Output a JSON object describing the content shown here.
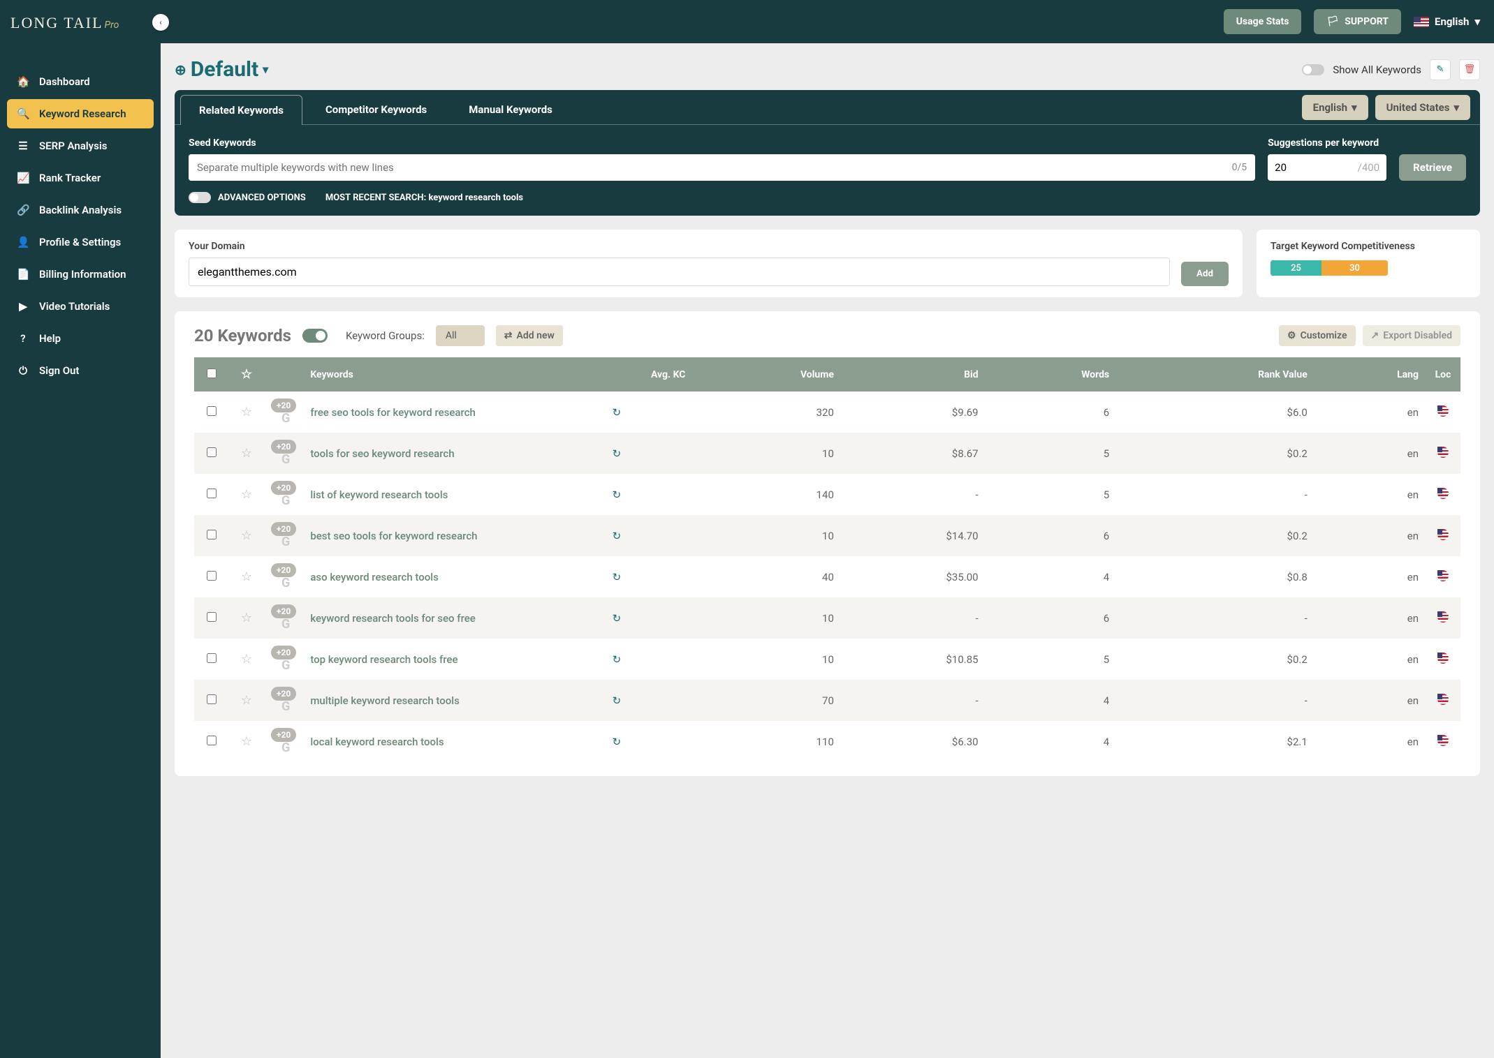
{
  "brand": {
    "name": "LONG TAIL",
    "suffix": "Pro"
  },
  "header": {
    "usage": "Usage Stats",
    "support": "SUPPORT",
    "language": "English"
  },
  "sidebar": {
    "items": [
      {
        "icon": "🏠",
        "label": "Dashboard"
      },
      {
        "icon": "🔍",
        "label": "Keyword Research"
      },
      {
        "icon": "☰",
        "label": "SERP Analysis"
      },
      {
        "icon": "📈",
        "label": "Rank Tracker"
      },
      {
        "icon": "🔗",
        "label": "Backlink Analysis"
      },
      {
        "icon": "👤",
        "label": "Profile & Settings"
      },
      {
        "icon": "📄",
        "label": "Billing Information"
      },
      {
        "icon": "▶",
        "label": "Video Tutorials"
      },
      {
        "icon": "?",
        "label": "Help"
      },
      {
        "icon": "⏻",
        "label": "Sign Out"
      }
    ]
  },
  "project": {
    "name": "Default",
    "show_all_label": "Show All Keywords"
  },
  "tabs": {
    "related": "Related Keywords",
    "competitor": "Competitor Keywords",
    "manual": "Manual Keywords",
    "lang_filter": "English",
    "country_filter": "United States"
  },
  "seed": {
    "label": "Seed Keywords",
    "placeholder": "Separate multiple keywords with new lines",
    "count": "0/5",
    "sugg_label": "Suggestions per keyword",
    "sugg_value": "20",
    "sugg_max": "/400",
    "retrieve": "Retrieve",
    "advanced": "ADVANCED OPTIONS",
    "recent_prefix": "MOST RECENT SEARCH: ",
    "recent_value": "keyword research tools"
  },
  "domain": {
    "label": "Your Domain",
    "value": "elegantthemes.com",
    "add": "Add"
  },
  "tkc": {
    "label": "Target Keyword Competitiveness",
    "low": "25",
    "high": "30"
  },
  "kw_section": {
    "count": "20 Keywords",
    "groups_label": "Keyword Groups:",
    "groups_value": "All",
    "add_new": "Add new",
    "customize": "Customize",
    "export": "Export Disabled"
  },
  "table": {
    "headers": {
      "keywords": "Keywords",
      "avgkc": "Avg. KC",
      "volume": "Volume",
      "bid": "Bid",
      "words": "Words",
      "rankvalue": "Rank Value",
      "lang": "Lang",
      "loc": "Loc"
    },
    "tag": "+20",
    "rows": [
      {
        "kw": "free seo tools for keyword research",
        "vol": "320",
        "bid": "$9.69",
        "words": "6",
        "rv": "$6.0",
        "lang": "en"
      },
      {
        "kw": "tools for seo keyword research",
        "vol": "10",
        "bid": "$8.67",
        "words": "5",
        "rv": "$0.2",
        "lang": "en"
      },
      {
        "kw": "list of keyword research tools",
        "vol": "140",
        "bid": "-",
        "words": "5",
        "rv": "-",
        "lang": "en"
      },
      {
        "kw": "best seo tools for keyword research",
        "vol": "10",
        "bid": "$14.70",
        "words": "6",
        "rv": "$0.2",
        "lang": "en"
      },
      {
        "kw": "aso keyword research tools",
        "vol": "40",
        "bid": "$35.00",
        "words": "4",
        "rv": "$0.8",
        "lang": "en"
      },
      {
        "kw": "keyword research tools for seo free",
        "vol": "10",
        "bid": "-",
        "words": "6",
        "rv": "-",
        "lang": "en"
      },
      {
        "kw": "top keyword research tools free",
        "vol": "10",
        "bid": "$10.85",
        "words": "5",
        "rv": "$0.2",
        "lang": "en"
      },
      {
        "kw": "multiple keyword research tools",
        "vol": "70",
        "bid": "-",
        "words": "4",
        "rv": "-",
        "lang": "en"
      },
      {
        "kw": "local keyword research tools",
        "vol": "110",
        "bid": "$6.30",
        "words": "4",
        "rv": "$2.1",
        "lang": "en"
      }
    ]
  }
}
